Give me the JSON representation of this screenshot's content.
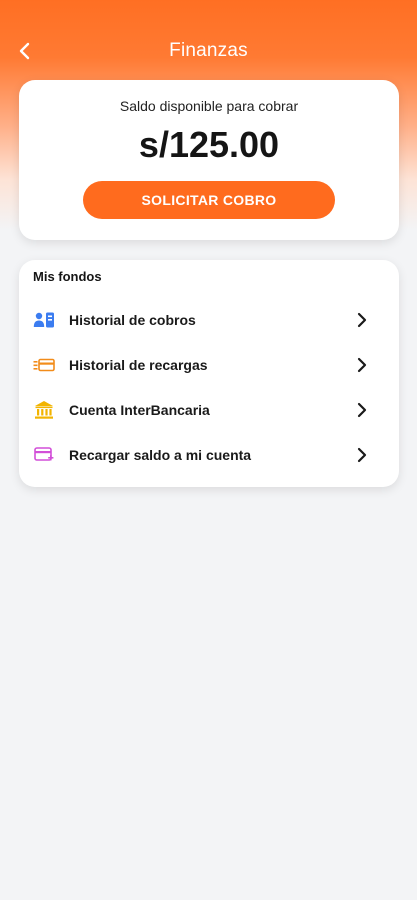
{
  "header": {
    "title": "Finanzas",
    "back_icon": "chevron-left-icon"
  },
  "balance": {
    "label": "Saldo disponible para cobrar",
    "amount": "s/125.00",
    "request_button": "SOLICITAR COBRO"
  },
  "funds": {
    "title": "Mis fondos",
    "items": [
      {
        "label": "Historial de cobros",
        "icon": "user-card-icon",
        "color": "#3b7cf0"
      },
      {
        "label": "Historial de recargas",
        "icon": "card-list-icon",
        "color": "#f28c1a"
      },
      {
        "label": "Cuenta InterBancaria",
        "icon": "bank-icon",
        "color": "#f2b400"
      },
      {
        "label": "Recargar saldo a mi cuenta",
        "icon": "card-add-icon",
        "color": "#d24fd8"
      }
    ]
  },
  "colors": {
    "accent": "#ff6b1e",
    "background": "#f3f4f6"
  }
}
